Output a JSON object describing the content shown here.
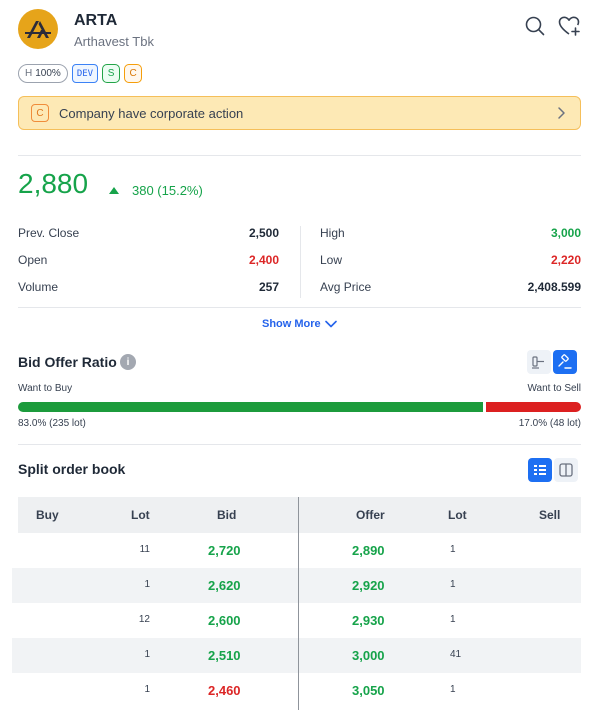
{
  "header": {
    "ticker": "ARTA",
    "company": "Arthavest Tbk"
  },
  "tags": {
    "h_label": "H",
    "h_value": "100%",
    "dev": "DEV",
    "s": "S",
    "c": "C"
  },
  "banner": {
    "badge": "C",
    "text": "Company have corporate action"
  },
  "price": {
    "last": "2,880",
    "change": "380 (15.2%)"
  },
  "stats": {
    "left": [
      {
        "label": "Prev. Close",
        "value": "2,500",
        "color": "dark"
      },
      {
        "label": "Open",
        "value": "2,400",
        "color": "red"
      },
      {
        "label": "Volume",
        "value": "257",
        "color": "dark"
      }
    ],
    "right": [
      {
        "label": "High",
        "value": "3,000",
        "color": "green"
      },
      {
        "label": "Low",
        "value": "2,220",
        "color": "red"
      },
      {
        "label": "Avg Price",
        "value": "2,408.599",
        "color": "dark"
      }
    ]
  },
  "show_more": "Show More",
  "bid_offer": {
    "title": "Bid Offer Ratio",
    "info": "i",
    "buy_label": "Want to Buy",
    "sell_label": "Want to Sell",
    "buy_fraction": 0.83,
    "buy_text": "83.0% (235 lot)",
    "sell_text": "17.0% (48 lot)"
  },
  "order_book": {
    "title": "Split order book",
    "columns": {
      "buy": "Buy",
      "lot_left": "Lot",
      "bid": "Bid",
      "offer": "Offer",
      "lot_right": "Lot",
      "sell": "Sell"
    },
    "rows": [
      {
        "bid_lot": "11",
        "bid": "2,720",
        "bid_color": "green",
        "offer": "2,890",
        "offer_color": "green",
        "offer_lot": "1"
      },
      {
        "bid_lot": "1",
        "bid": "2,620",
        "bid_color": "green",
        "offer": "2,920",
        "offer_color": "green",
        "offer_lot": "1"
      },
      {
        "bid_lot": "12",
        "bid": "2,600",
        "bid_color": "green",
        "offer": "2,930",
        "offer_color": "green",
        "offer_lot": "1"
      },
      {
        "bid_lot": "1",
        "bid": "2,510",
        "bid_color": "green",
        "offer": "3,000",
        "offer_color": "green",
        "offer_lot": "41"
      },
      {
        "bid_lot": "1",
        "bid": "2,460",
        "bid_color": "red",
        "offer": "3,050",
        "offer_color": "green",
        "offer_lot": "1"
      }
    ]
  },
  "colors": {
    "green": "#16a34a",
    "red": "#dc2626",
    "accent": "#1d6ff2",
    "banner_bg": "#fde9b5"
  }
}
